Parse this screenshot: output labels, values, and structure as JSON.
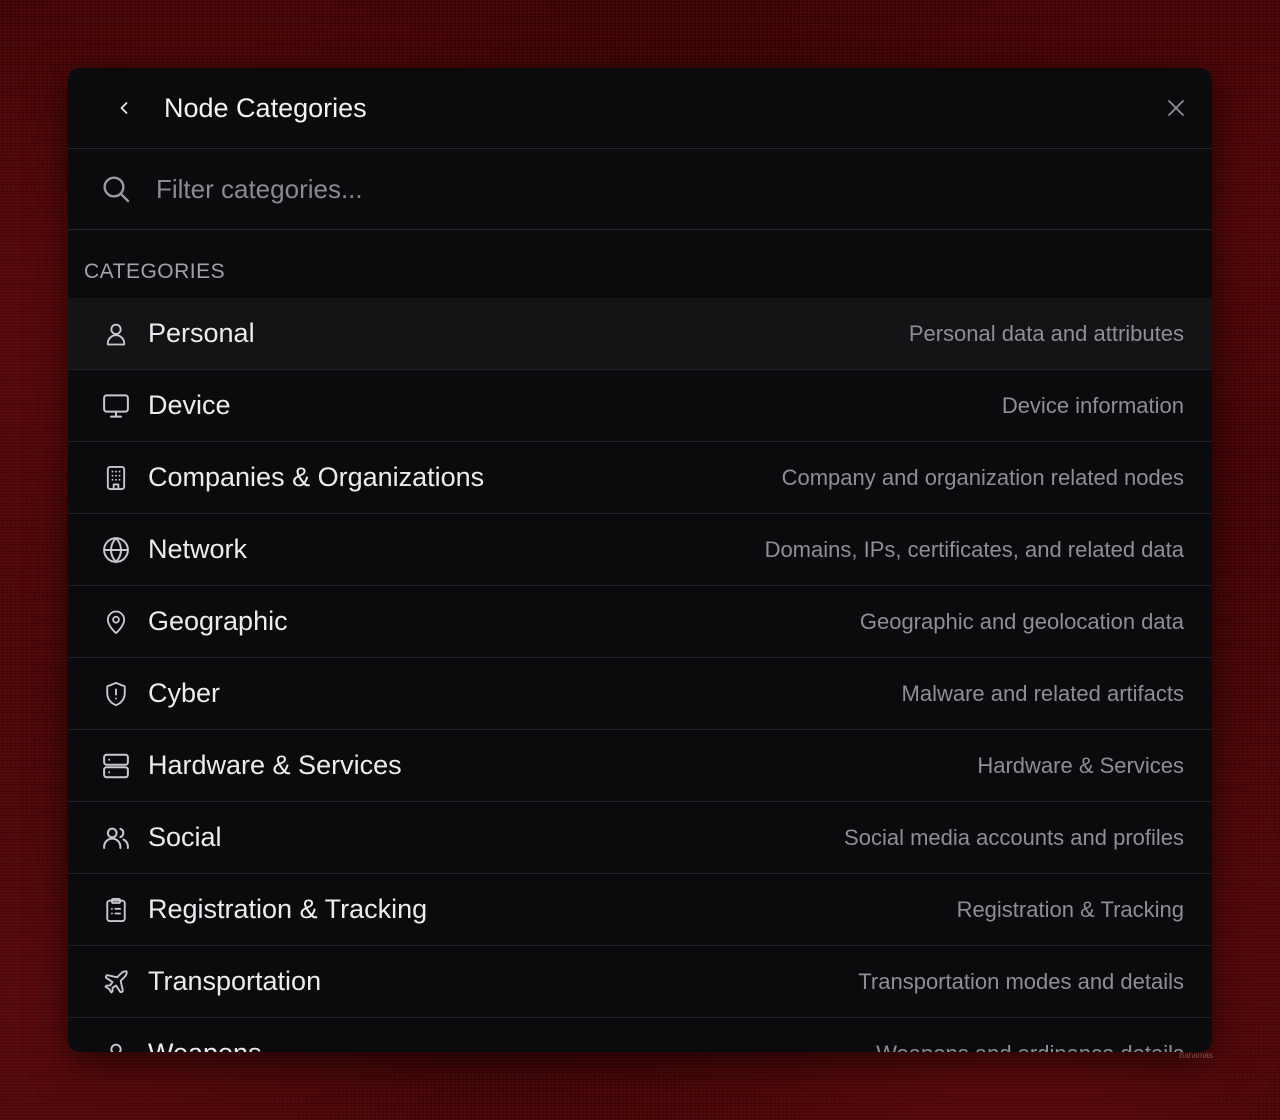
{
  "header": {
    "title": "Node Categories",
    "back_icon": "chevron-left-icon",
    "close_icon": "close-icon"
  },
  "search": {
    "placeholder": "Filter categories...",
    "value": ""
  },
  "section": {
    "label": "CATEGORIES"
  },
  "categories": [
    {
      "label": "Personal",
      "description": "Personal data and attributes",
      "icon": "user-icon",
      "active": true
    },
    {
      "label": "Device",
      "description": "Device information",
      "icon": "monitor-icon"
    },
    {
      "label": "Companies & Organizations",
      "description": "Company and organization related nodes",
      "icon": "building-icon"
    },
    {
      "label": "Network",
      "description": "Domains, IPs, certificates, and related data",
      "icon": "globe-icon"
    },
    {
      "label": "Geographic",
      "description": "Geographic and geolocation data",
      "icon": "map-pin-icon"
    },
    {
      "label": "Cyber",
      "description": "Malware and related artifacts",
      "icon": "shield-alert-icon"
    },
    {
      "label": "Hardware & Services",
      "description": "Hardware & Services",
      "icon": "server-icon"
    },
    {
      "label": "Social",
      "description": "Social media accounts and profiles",
      "icon": "users-icon"
    },
    {
      "label": "Registration & Tracking",
      "description": "Registration & Tracking",
      "icon": "clipboard-list-icon"
    },
    {
      "label": "Transportation",
      "description": "Transportation modes and details",
      "icon": "plane-icon"
    },
    {
      "label": "Weapons",
      "description": "Weapons and ordinance details",
      "icon": "user-icon"
    }
  ],
  "background": {
    "map_label": "Bahamas"
  },
  "colors": {
    "modal_bg": "#0b0b0d",
    "active_row_bg": "#141416",
    "text_primary": "#ececef",
    "text_secondary": "#8e8e95",
    "background": "#2a0304"
  }
}
